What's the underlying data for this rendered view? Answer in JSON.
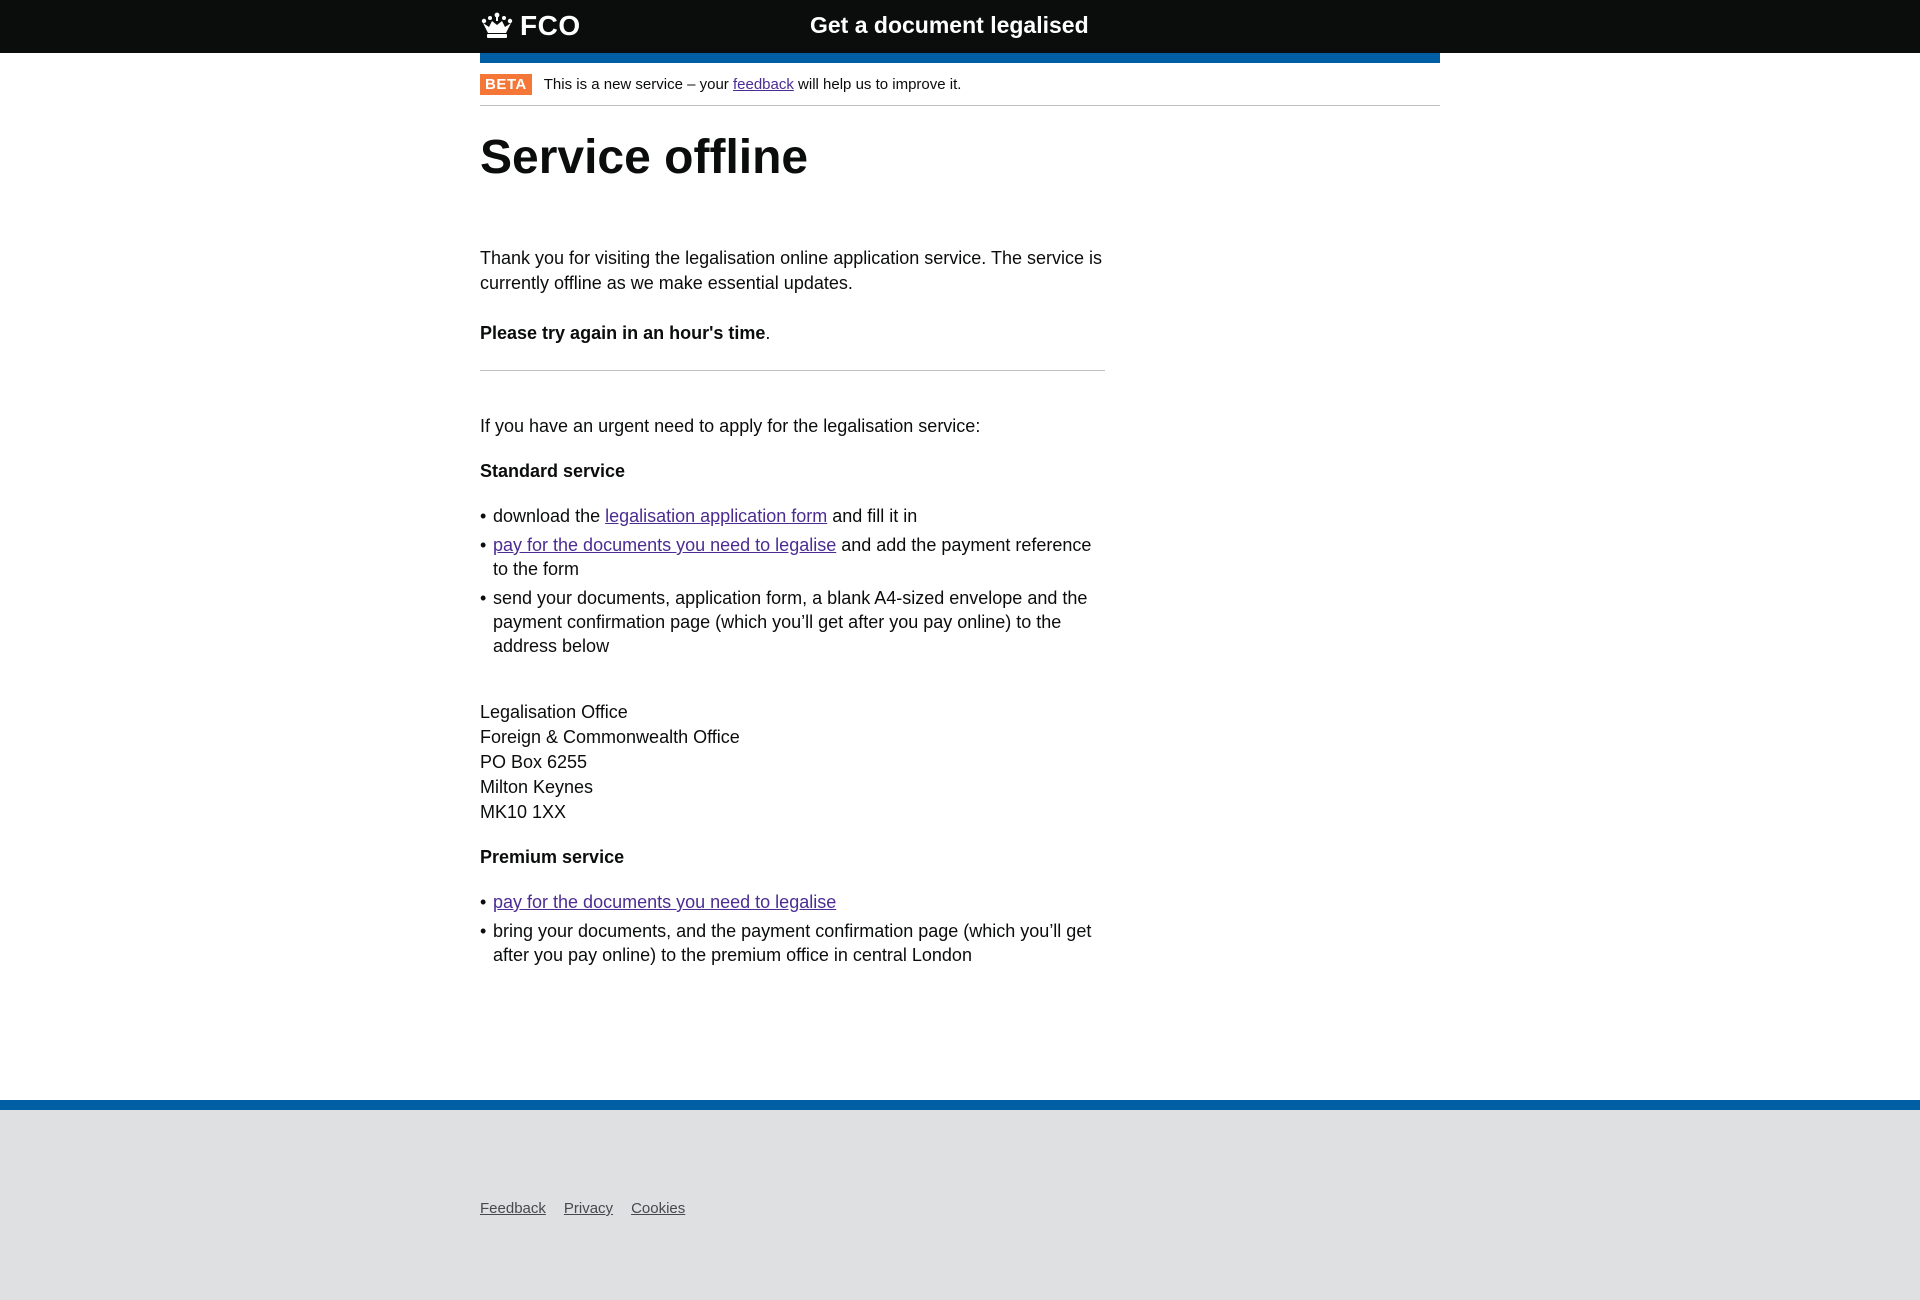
{
  "header": {
    "logo_text": "FCO",
    "logo_icon": "crown-icon",
    "service_name": "Get a document legalised"
  },
  "phase_banner": {
    "tag": "BETA",
    "text_before": "This is a new service – your ",
    "link_text": "feedback",
    "text_after": " will help us to improve it."
  },
  "main": {
    "title": "Service offline",
    "intro": "Thank you for visiting the legalisation online application service. The service is currently offline as we make essential updates.",
    "try_again": "Please try again in an hour's time",
    "try_again_suffix": ".",
    "urgent": "If you have an urgent need to apply for the legalisation service:",
    "standard": {
      "heading": "Standard service",
      "item1_before": "download the ",
      "item1_link": "legalisation application form",
      "item1_after": " and fill it in",
      "item2_link": "pay for the documents you need to legalise",
      "item2_after": " and add the payment reference to the form",
      "item3": "send your documents, application form, a blank A4-sized envelope and the payment confirmation page (which you’ll get after you pay online) to the address below"
    },
    "address": {
      "line1": "Legalisation Office",
      "line2": "Foreign & Commonwealth Office",
      "line3": "PO Box 6255",
      "line4": "Milton Keynes",
      "line5": "MK10 1XX"
    },
    "premium": {
      "heading": "Premium service",
      "item1_link": "pay for the documents you need to legalise",
      "item2": "bring your documents, and the payment confirmation page (which you’ll get after you pay online) to the premium office in central London"
    }
  },
  "footer": {
    "links": [
      "Feedback",
      "Privacy",
      "Cookies"
    ]
  },
  "colors": {
    "header_bg": "#0b0c0c",
    "brand_blue": "#005ea5",
    "beta_orange": "#f47738",
    "link": "#4c2c92",
    "footer_bg": "#dee0e2"
  }
}
